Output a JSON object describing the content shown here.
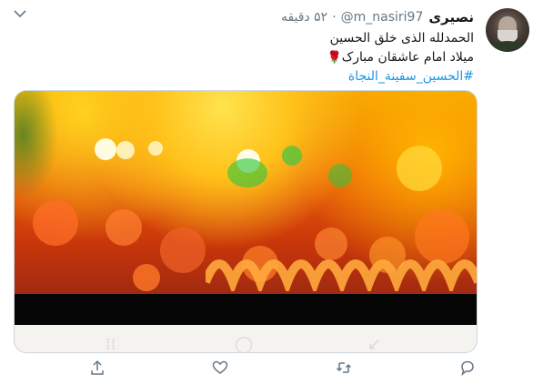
{
  "tweet": {
    "display_name": "نصیری",
    "handle": "@m_nasiri97",
    "separator": "·",
    "time": "۵۲ دقیقه",
    "lines": [
      "الحمدلله الذی خلق الحسین",
      "میلاد امام عاشقان مبارک"
    ],
    "hashtag": "#الحسین_سفینة_النجاة"
  },
  "icons": {
    "menu": "chevron-down-icon",
    "rose": "rose-emoji",
    "reply": "reply-icon",
    "retweet": "retweet-icon",
    "like": "heart-icon",
    "share": "share-icon"
  },
  "colors": {
    "link": "#1b95e0",
    "secondary_text": "#657786",
    "border": "#ccd6dd"
  }
}
